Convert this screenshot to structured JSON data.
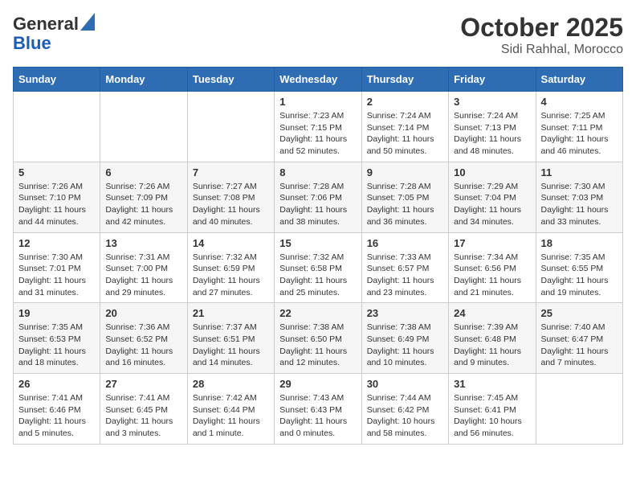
{
  "header": {
    "logo_general": "General",
    "logo_blue": "Blue",
    "month": "October 2025",
    "location": "Sidi Rahhal, Morocco"
  },
  "weekdays": [
    "Sunday",
    "Monday",
    "Tuesday",
    "Wednesday",
    "Thursday",
    "Friday",
    "Saturday"
  ],
  "weeks": [
    [
      {
        "day": "",
        "info": ""
      },
      {
        "day": "",
        "info": ""
      },
      {
        "day": "",
        "info": ""
      },
      {
        "day": "1",
        "info": "Sunrise: 7:23 AM\nSunset: 7:15 PM\nDaylight: 11 hours and 52 minutes."
      },
      {
        "day": "2",
        "info": "Sunrise: 7:24 AM\nSunset: 7:14 PM\nDaylight: 11 hours and 50 minutes."
      },
      {
        "day": "3",
        "info": "Sunrise: 7:24 AM\nSunset: 7:13 PM\nDaylight: 11 hours and 48 minutes."
      },
      {
        "day": "4",
        "info": "Sunrise: 7:25 AM\nSunset: 7:11 PM\nDaylight: 11 hours and 46 minutes."
      }
    ],
    [
      {
        "day": "5",
        "info": "Sunrise: 7:26 AM\nSunset: 7:10 PM\nDaylight: 11 hours and 44 minutes."
      },
      {
        "day": "6",
        "info": "Sunrise: 7:26 AM\nSunset: 7:09 PM\nDaylight: 11 hours and 42 minutes."
      },
      {
        "day": "7",
        "info": "Sunrise: 7:27 AM\nSunset: 7:08 PM\nDaylight: 11 hours and 40 minutes."
      },
      {
        "day": "8",
        "info": "Sunrise: 7:28 AM\nSunset: 7:06 PM\nDaylight: 11 hours and 38 minutes."
      },
      {
        "day": "9",
        "info": "Sunrise: 7:28 AM\nSunset: 7:05 PM\nDaylight: 11 hours and 36 minutes."
      },
      {
        "day": "10",
        "info": "Sunrise: 7:29 AM\nSunset: 7:04 PM\nDaylight: 11 hours and 34 minutes."
      },
      {
        "day": "11",
        "info": "Sunrise: 7:30 AM\nSunset: 7:03 PM\nDaylight: 11 hours and 33 minutes."
      }
    ],
    [
      {
        "day": "12",
        "info": "Sunrise: 7:30 AM\nSunset: 7:01 PM\nDaylight: 11 hours and 31 minutes."
      },
      {
        "day": "13",
        "info": "Sunrise: 7:31 AM\nSunset: 7:00 PM\nDaylight: 11 hours and 29 minutes."
      },
      {
        "day": "14",
        "info": "Sunrise: 7:32 AM\nSunset: 6:59 PM\nDaylight: 11 hours and 27 minutes."
      },
      {
        "day": "15",
        "info": "Sunrise: 7:32 AM\nSunset: 6:58 PM\nDaylight: 11 hours and 25 minutes."
      },
      {
        "day": "16",
        "info": "Sunrise: 7:33 AM\nSunset: 6:57 PM\nDaylight: 11 hours and 23 minutes."
      },
      {
        "day": "17",
        "info": "Sunrise: 7:34 AM\nSunset: 6:56 PM\nDaylight: 11 hours and 21 minutes."
      },
      {
        "day": "18",
        "info": "Sunrise: 7:35 AM\nSunset: 6:55 PM\nDaylight: 11 hours and 19 minutes."
      }
    ],
    [
      {
        "day": "19",
        "info": "Sunrise: 7:35 AM\nSunset: 6:53 PM\nDaylight: 11 hours and 18 minutes."
      },
      {
        "day": "20",
        "info": "Sunrise: 7:36 AM\nSunset: 6:52 PM\nDaylight: 11 hours and 16 minutes."
      },
      {
        "day": "21",
        "info": "Sunrise: 7:37 AM\nSunset: 6:51 PM\nDaylight: 11 hours and 14 minutes."
      },
      {
        "day": "22",
        "info": "Sunrise: 7:38 AM\nSunset: 6:50 PM\nDaylight: 11 hours and 12 minutes."
      },
      {
        "day": "23",
        "info": "Sunrise: 7:38 AM\nSunset: 6:49 PM\nDaylight: 11 hours and 10 minutes."
      },
      {
        "day": "24",
        "info": "Sunrise: 7:39 AM\nSunset: 6:48 PM\nDaylight: 11 hours and 9 minutes."
      },
      {
        "day": "25",
        "info": "Sunrise: 7:40 AM\nSunset: 6:47 PM\nDaylight: 11 hours and 7 minutes."
      }
    ],
    [
      {
        "day": "26",
        "info": "Sunrise: 7:41 AM\nSunset: 6:46 PM\nDaylight: 11 hours and 5 minutes."
      },
      {
        "day": "27",
        "info": "Sunrise: 7:41 AM\nSunset: 6:45 PM\nDaylight: 11 hours and 3 minutes."
      },
      {
        "day": "28",
        "info": "Sunrise: 7:42 AM\nSunset: 6:44 PM\nDaylight: 11 hours and 1 minute."
      },
      {
        "day": "29",
        "info": "Sunrise: 7:43 AM\nSunset: 6:43 PM\nDaylight: 11 hours and 0 minutes."
      },
      {
        "day": "30",
        "info": "Sunrise: 7:44 AM\nSunset: 6:42 PM\nDaylight: 10 hours and 58 minutes."
      },
      {
        "day": "31",
        "info": "Sunrise: 7:45 AM\nSunset: 6:41 PM\nDaylight: 10 hours and 56 minutes."
      },
      {
        "day": "",
        "info": ""
      }
    ]
  ]
}
